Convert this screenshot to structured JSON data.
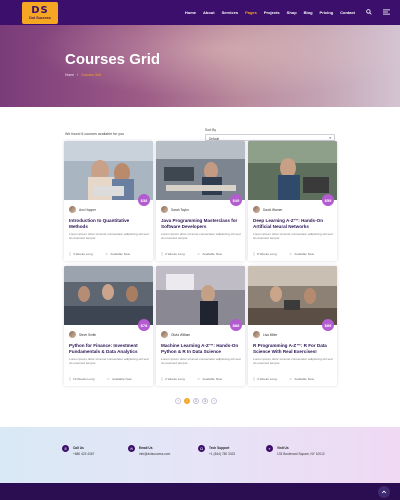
{
  "header": {
    "logo_mark": "DS",
    "logo_text": "Dot Success",
    "nav": [
      "Home",
      "About",
      "Services",
      "Pages",
      "Projects",
      "Shop",
      "Blog",
      "Pricing",
      "Contact"
    ],
    "active_nav": "Pages",
    "icons": [
      "search-icon",
      "menu-icon"
    ]
  },
  "hero": {
    "title": "Courses Grid",
    "breadcrumb": [
      "Home",
      "Courses Grid"
    ]
  },
  "filter": {
    "result_count": "We found 6 courses available for you",
    "sort_label": "Sort By",
    "sort_value": "Default"
  },
  "courses": [
    {
      "author": "Ann Hopper",
      "price": "$38",
      "title": "Introduction to Quantitative Methods",
      "desc": "Lorem ipsum dolor sit amet consectetur adipiscing elit sed do eiusmod tempor.",
      "duration": "3 Weeks Long",
      "availability": "Available Now",
      "thumb": "#9aa9b8"
    },
    {
      "author": "Sarah Taylor",
      "price": "$49",
      "title": "Java Programming Masterclass for Software Developers",
      "desc": "Lorem ipsum dolor sit amet consectetur adipiscing elit sed do eiusmod tempor.",
      "duration": "2 Weeks Long",
      "availability": "Available Now",
      "thumb": "#8a8f96"
    },
    {
      "author": "David Warner",
      "price": "$59",
      "title": "Deep Learning A-Z™: Hands-On Artificial Neural Networks",
      "desc": "Lorem ipsum dolor sit amet consectetur adipiscing elit sed do eiusmod tempor.",
      "duration": "8 Weeks Long",
      "availability": "Available Now",
      "thumb": "#6b7d6c"
    },
    {
      "author": "Steve Smith",
      "price": "$78",
      "title": "Python for Finance: Investment Fundamentals & Data Analytics",
      "desc": "Lorem ipsum dolor sit amet consectetur adipiscing elit sed do eiusmod tempor.",
      "duration": "10 Weeks Long",
      "availability": "Available Now",
      "thumb": "#6d7480"
    },
    {
      "author": "Olivia William",
      "price": "$88",
      "title": "Machine Learning A-Z™: Hands-On Python & R In Data Science",
      "desc": "Lorem ipsum dolor sit amet consectetur adipiscing elit sed do eiusmod tempor.",
      "duration": "2 Weeks Long",
      "availability": "Available Now",
      "thumb": "#8b8a93"
    },
    {
      "author": "Lisa Miller",
      "price": "$89",
      "title": "R Programming A-Z™: R For Data Science With Real Exercises!",
      "desc": "Lorem ipsum dolor sit amet consectetur adipiscing elit sed do eiusmod tempor.",
      "duration": "3 Weeks Long",
      "availability": "Available Now",
      "thumb": "#8c7f72"
    }
  ],
  "pagination": {
    "prev": "‹",
    "pages": [
      "1",
      "2",
      "3"
    ],
    "active": "1",
    "next": "›"
  },
  "contact": [
    {
      "label": "Call Us",
      "value": "+880 423 4367",
      "icon": "phone-icon"
    },
    {
      "label": "Email Us",
      "value": "info@dotsuccess.com",
      "icon": "mail-icon"
    },
    {
      "label": "Tech Support",
      "value": "+1 (844) 780 3323",
      "icon": "headset-icon"
    },
    {
      "label": "Visit Us",
      "value": "133 Boulevard Square, NY 10012",
      "icon": "map-pin-icon"
    }
  ],
  "colors": {
    "primary": "#3b0f6b",
    "accent": "#f5a623",
    "price_badge": "#b35bd0"
  }
}
